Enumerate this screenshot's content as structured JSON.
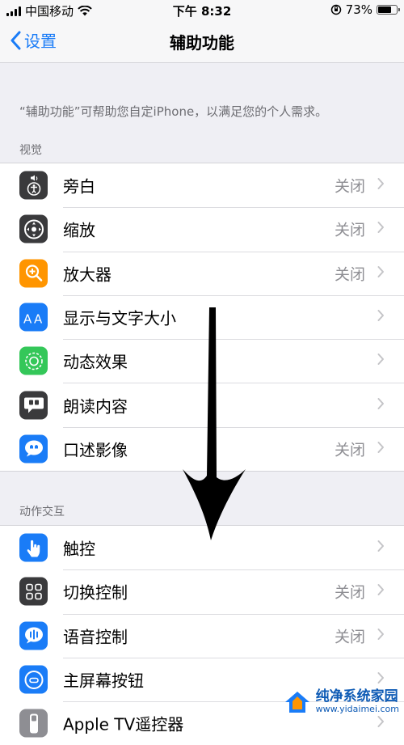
{
  "status_bar": {
    "carrier": "中国移动",
    "time": "下午 8:32",
    "battery_percent": "73%",
    "battery_level": 0.73
  },
  "nav": {
    "back_label": "设置",
    "title": "辅助功能"
  },
  "intro": "“辅助功能”可帮助您自定iPhone，以满足您的个人需求。",
  "sections": {
    "vision": {
      "header": "视觉",
      "items": [
        {
          "label": "旁白",
          "value": "关闭",
          "icon": "voiceover-icon",
          "icon_bg": "#3a3a3c"
        },
        {
          "label": "缩放",
          "value": "关闭",
          "icon": "zoom-icon",
          "icon_bg": "#3a3a3c"
        },
        {
          "label": "放大器",
          "value": "关闭",
          "icon": "magnifier-icon",
          "icon_bg": "#ff9500"
        },
        {
          "label": "显示与文字大小",
          "value": "",
          "icon": "text-size-icon",
          "icon_bg": "#1a7cf7"
        },
        {
          "label": "动态效果",
          "value": "",
          "icon": "motion-icon",
          "icon_bg": "#34c759"
        },
        {
          "label": "朗读内容",
          "value": "",
          "icon": "spoken-content-icon",
          "icon_bg": "#3a3a3c"
        },
        {
          "label": "口述影像",
          "value": "关闭",
          "icon": "audio-description-icon",
          "icon_bg": "#1a7cf7"
        }
      ]
    },
    "interaction": {
      "header": "动作交互",
      "items": [
        {
          "label": "触控",
          "value": "",
          "icon": "touch-icon",
          "icon_bg": "#1a7cf7"
        },
        {
          "label": "切换控制",
          "value": "关闭",
          "icon": "switch-control-icon",
          "icon_bg": "#3a3a3c"
        },
        {
          "label": "语音控制",
          "value": "关闭",
          "icon": "voice-control-icon",
          "icon_bg": "#1a7cf7"
        },
        {
          "label": "主屏幕按钮",
          "value": "",
          "icon": "home-button-icon",
          "icon_bg": "#1a7cf7"
        },
        {
          "label": "Apple TV遥控器",
          "value": "",
          "icon": "apple-tv-remote-icon",
          "icon_bg": "#8e8e93"
        }
      ]
    }
  },
  "watermark": {
    "title": "纯净系统家园",
    "url": "www.yidaimei.com"
  },
  "colors": {
    "accent": "#1a7cf7",
    "background": "#efeff4",
    "secondary_text": "#8e8e93"
  }
}
